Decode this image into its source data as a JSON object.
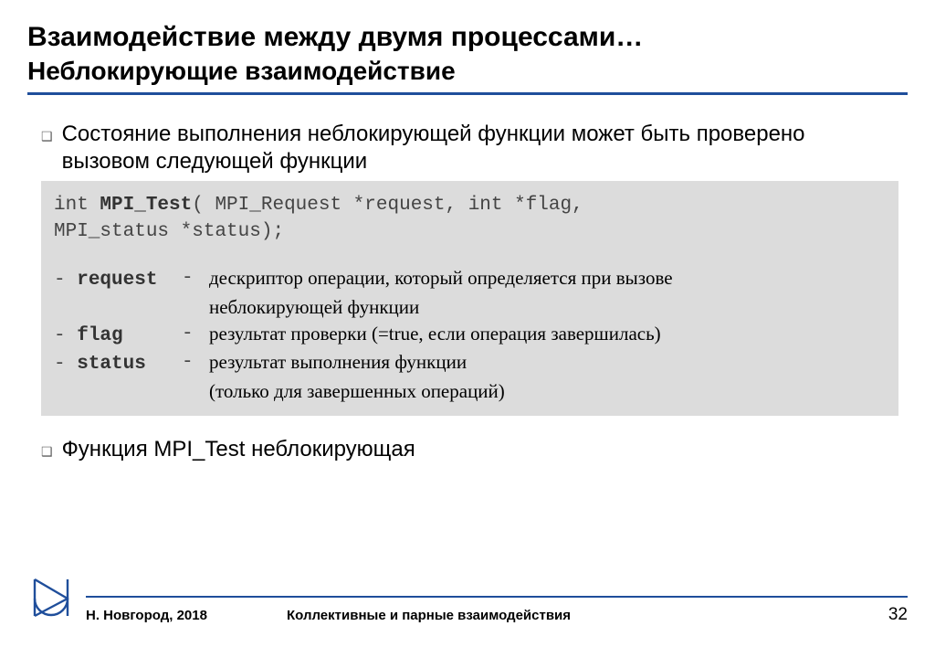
{
  "header": {
    "title1": "Взаимодействие между двумя процессами…",
    "title2": "Неблокирующие взаимодействие"
  },
  "bullets": {
    "item0": "Состояние выполнения неблокирующей функции может быть проверено вызовом следующей функции",
    "item1": "Функция MPI_Test неблокирующая"
  },
  "code": {
    "sig_prefix": "int ",
    "sig_name": "MPI_Test",
    "sig_rest1": "( MPI_Request *request, int *flag,",
    "sig_rest2": "  MPI_status *status);",
    "p1_key": "request",
    "p1_desc_a": "дескриптор операции, который определяется при вызове",
    "p1_desc_b": "неблокирующей функции",
    "p2_key": "flag",
    "p2_desc": "результат проверки (=true, если операция завершилась)",
    "p3_key": "status",
    "p3_desc_a": "результат выполнения функции",
    "p3_desc_b": "(только для завершенных операций)"
  },
  "footer": {
    "left": "Н. Новгород, 2018",
    "mid": "Коллективные и парные взаимодействия",
    "page": "32"
  }
}
